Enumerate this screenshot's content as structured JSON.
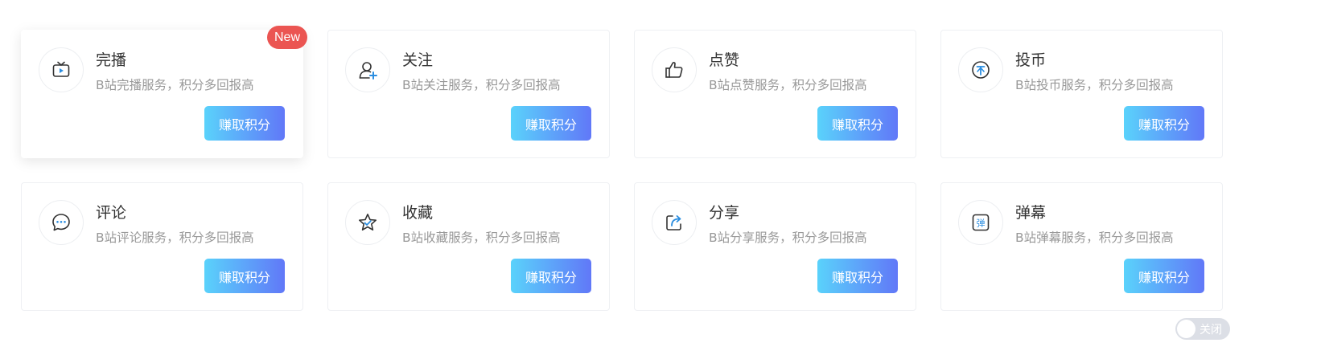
{
  "services": [
    {
      "id": "finish-play",
      "title": "完播",
      "desc": "B站完播服务，积分多回报高",
      "button": "赚取积分",
      "icon": "tv-icon",
      "badge": "New"
    },
    {
      "id": "follow",
      "title": "关注",
      "desc": "B站关注服务，积分多回报高",
      "button": "赚取积分",
      "icon": "user-plus-icon"
    },
    {
      "id": "like",
      "title": "点赞",
      "desc": "B站点赞服务，积分多回报高",
      "button": "赚取积分",
      "icon": "thumbs-up-icon"
    },
    {
      "id": "coin",
      "title": "投币",
      "desc": "B站投币服务，积分多回报高",
      "button": "赚取积分",
      "icon": "coin-icon"
    },
    {
      "id": "comment",
      "title": "评论",
      "desc": "B站评论服务，积分多回报高",
      "button": "赚取积分",
      "icon": "comment-icon"
    },
    {
      "id": "favorite",
      "title": "收藏",
      "desc": "B站收藏服务，积分多回报高",
      "button": "赚取积分",
      "icon": "star-icon"
    },
    {
      "id": "share",
      "title": "分享",
      "desc": "B站分享服务，积分多回报高",
      "button": "赚取积分",
      "icon": "share-icon"
    },
    {
      "id": "danmaku",
      "title": "弹幕",
      "desc": "B站弹幕服务，积分多回报高",
      "button": "赚取积分",
      "icon": "danmaku-icon",
      "icon_text": "弹"
    }
  ],
  "toggle": {
    "label": "关闭",
    "state": "off"
  },
  "colors": {
    "accent_blue": "#2a8de0",
    "button_gradient_start": "#5ad2fb",
    "button_gradient_end": "#6178f8",
    "badge": "#eb5552",
    "icon_stroke": "#333333"
  }
}
